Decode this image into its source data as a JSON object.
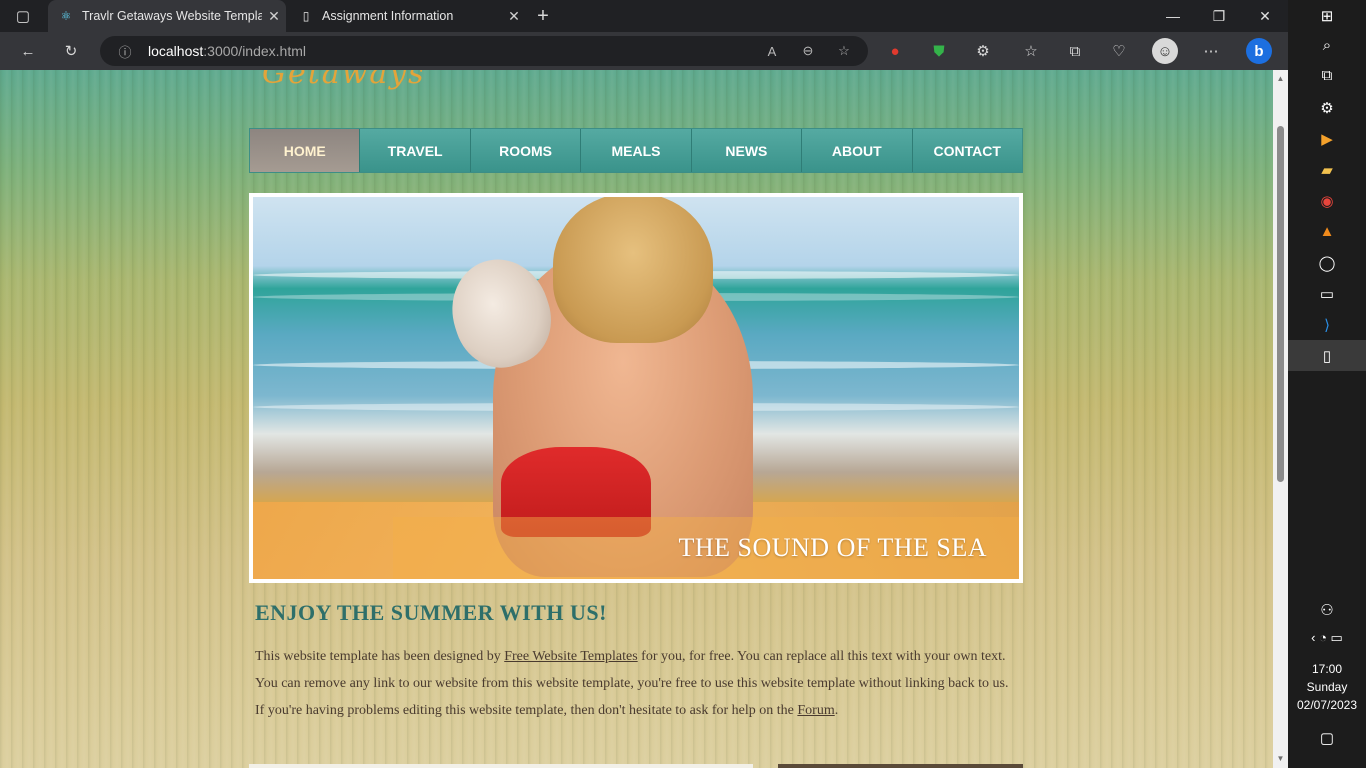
{
  "browser": {
    "tabs": [
      {
        "title": "Travlr Getaways Website Templat",
        "active": true,
        "favicon": "react-icon"
      },
      {
        "title": "Assignment Information",
        "active": false,
        "favicon": "page-icon"
      }
    ],
    "url_host": "localhost",
    "url_path": ":3000/index.html"
  },
  "page": {
    "logo_text": "Getaways",
    "nav": [
      "HOME",
      "TRAVEL",
      "ROOMS",
      "MEALS",
      "NEWS",
      "ABOUT",
      "CONTACT"
    ],
    "nav_current": "HOME",
    "hero_caption": "THE SOUND OF THE SEA",
    "heading": "ENJOY THE SUMMER WITH US!",
    "intro": {
      "part1": "This website template has been designed by ",
      "link1": "Free Website Templates",
      "part2": " for you, for free. You can replace all this text with your own text. You can remove any link to our website from this website template, you're free to use this website template without linking back to us. If you're having problems editing this website template, then don't hesitate to ask for help on the ",
      "link2": "Forum",
      "part3": "."
    }
  },
  "taskbar": {
    "time": "17:00",
    "day": "Sunday",
    "date": "02/07/2023"
  },
  "colors": {
    "nav_teal": "#3a938b",
    "nav_current": "#9b928a",
    "heading": "#2e6f6a",
    "logo": "#e3a43a"
  }
}
